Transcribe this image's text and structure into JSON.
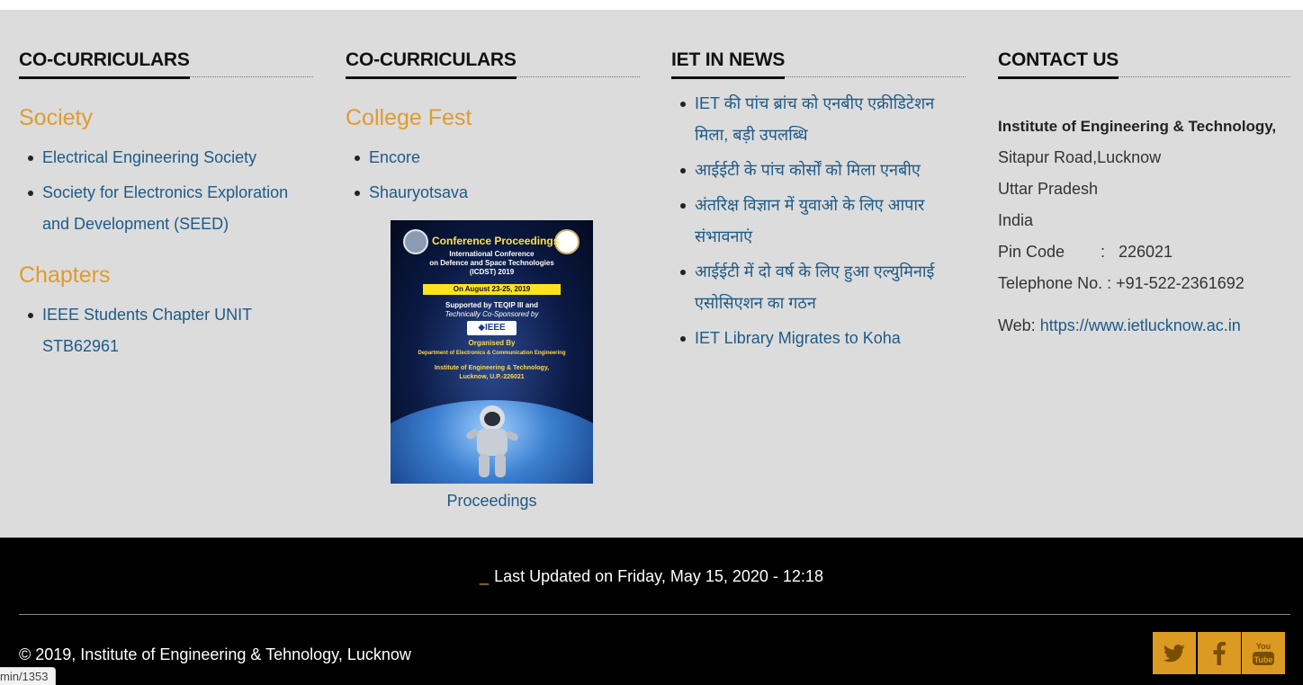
{
  "columns": {
    "cocurricular1": {
      "heading": "CO-CURRICULARS",
      "society_title": "Society",
      "society_items": [
        "Electrical Engineering Society",
        "Society for Electronics Exploration and Development (SEED)"
      ],
      "chapters_title": "Chapters",
      "chapter_items": [
        "IEEE Students Chapter UNIT STB62961"
      ]
    },
    "cocurricular2": {
      "heading": "CO-CURRICULARS",
      "fest_title": "College Fest",
      "fest_items": [
        "Encore",
        "Shauryotsava"
      ],
      "poster": {
        "title": "Conference Proceedings",
        "line1": "International Conference",
        "line2": "on Defence and Space Technologies",
        "line3": "(ICDST) 2019",
        "date": "On August 23-25, 2019",
        "support": "Supported by TEQIP III and",
        "cosponsor": "Technically Co-Sponsored by",
        "ieee": "◆IEEE",
        "organised": "Organised By",
        "dept": "Department of Electronics & Communication Engineering",
        "inst": "Institute of Engineering & Technology,",
        "city": "Lucknow, U.P.-226021"
      },
      "caption": "Proceedings"
    },
    "news": {
      "heading": "IET IN NEWS",
      "items": [
        "IET की पांच ब्रांच को एनबीए एक्रीडिटेशन मिला, बड़ी उपलब्धि",
        "आईईटी के पांच कोर्सों को मिला एनबीए",
        "अंतरिक्ष विज्ञान में युवाओ के लिए आपार संभावनाएं",
        "आईईटी में दो वर्ष के लिए हुआ एल्युमिनाई एसोसिएशन का गठन",
        "IET Library Migrates to Koha"
      ]
    },
    "contact": {
      "heading": "CONTACT US",
      "name": "Institute of Engineering & Technology,",
      "address1": "Sitapur Road,Lucknow",
      "state": "Uttar Pradesh",
      "country": "India",
      "pin_label": "Pin Code",
      "pin_value": ":   226021",
      "phone_label": "Telephone No.",
      "phone_value": ": +91-522-2361692",
      "web_label": "Web:",
      "web_url": "https://www.ietlucknow.ac.in"
    }
  },
  "bottom": {
    "updated_prefix": "_",
    "updated_text": "Last Updated on Friday, May 15, 2020 - 12:18",
    "copyright": "© 2019, Institute of Engineering & Tehnology, Lucknow",
    "social": [
      "twitter-icon",
      "facebook-icon",
      "youtube-icon"
    ]
  },
  "status_bar": {
    "url": "min/1353"
  },
  "colors": {
    "accent": "#e09b2d",
    "link": "#1e5a87",
    "panel": "#dcdcdc",
    "footer": "#000000",
    "social_bg": "#dc9a22"
  }
}
